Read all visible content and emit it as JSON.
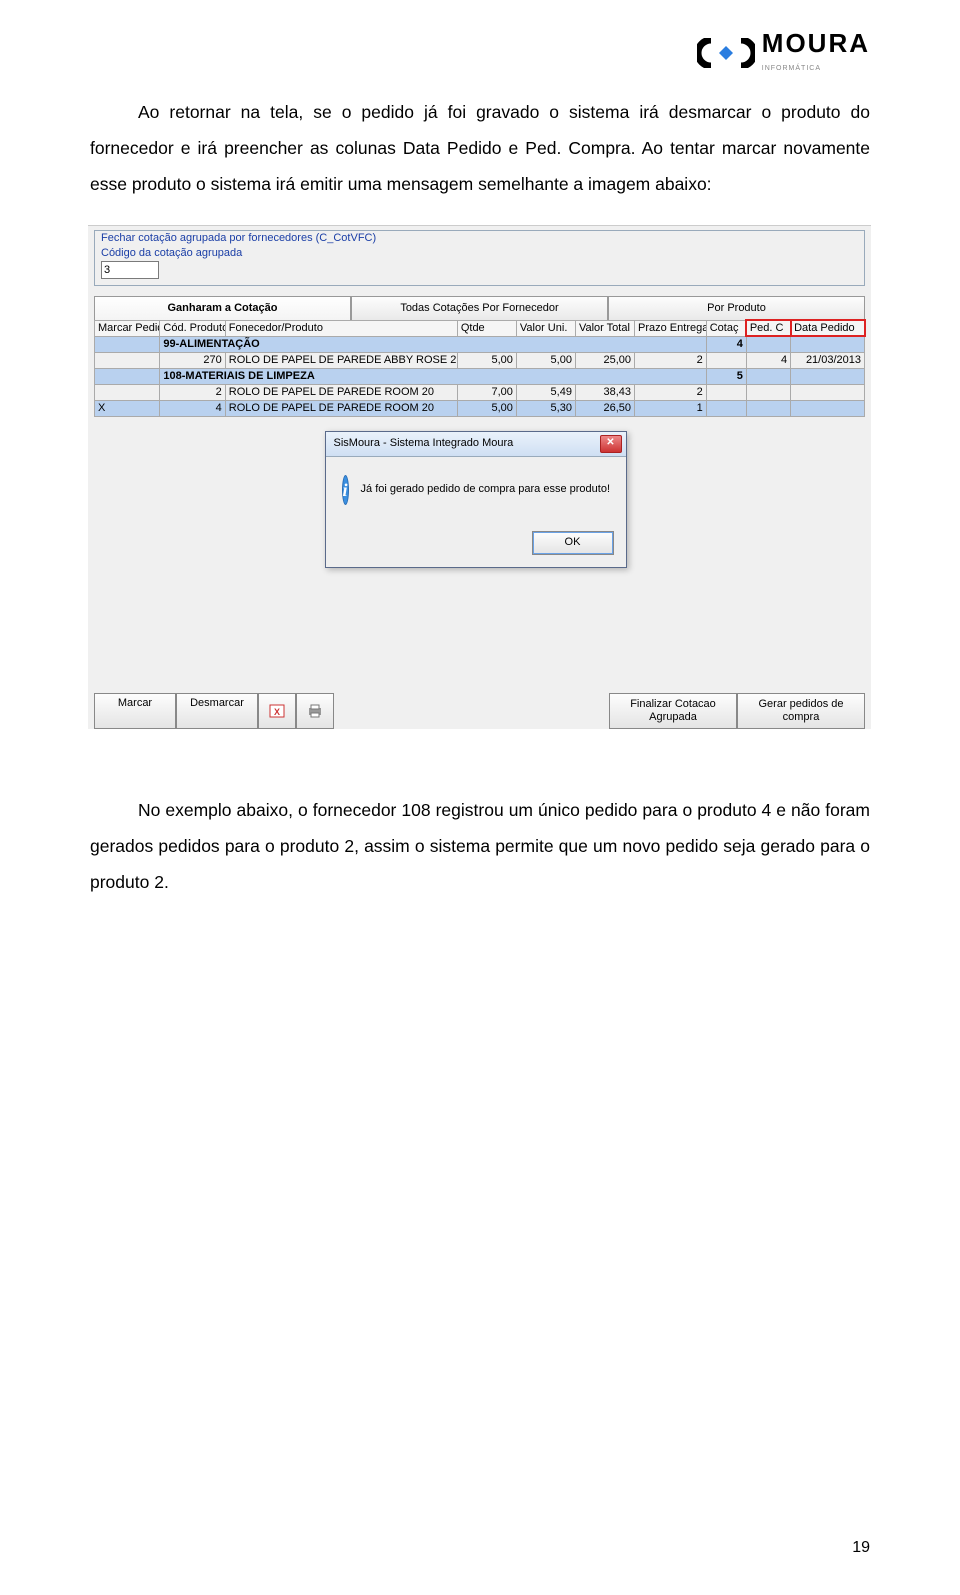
{
  "logo": {
    "brand": "MOURA",
    "sub": "INFORMÁTICA"
  },
  "para1": "Ao retornar na tela, se o pedido já foi gravado o sistema irá desmarcar o produto do fornecedor e irá preencher as colunas Data Pedido e Ped. Compra. Ao tentar marcar novamente esse produto o sistema irá emitir uma mensagem semelhante a imagem abaixo:",
  "para2": "No exemplo abaixo, o fornecedor 108 registrou um único pedido para o produto 4 e não foram gerados pedidos para o produto 2, assim o sistema permite que um novo pedido seja gerado para o produto 2.",
  "pagenum": "19",
  "shot": {
    "legend": "Fechar cotação agrupada por fornecedores (C_CotVFC)",
    "code_label": "Código da cotação agrupada",
    "code_value": "3",
    "tabs": [
      "Ganharam a Cotação",
      "Todas Cotações Por Fornecedor",
      "Por Produto"
    ],
    "cols": [
      "Marcar Pedid",
      "Cód. Produto",
      "Fonecedor/Produto",
      "Qtde",
      "Valor Uni.",
      "Valor Total",
      "Prazo Entrega",
      "Cotaç",
      "Ped. C",
      "Data Pedido"
    ],
    "rows": [
      {
        "type": "group",
        "label": "99-ALIMENTAÇÃO",
        "cotac": "4"
      },
      {
        "type": "data",
        "m": "",
        "cod": "270",
        "prod": "ROLO DE PAPEL DE PAREDE ABBY ROSE 2",
        "q": "5,00",
        "vu": "5,00",
        "vt": "25,00",
        "pe": "2",
        "cot": "",
        "pc": "4",
        "dp": "21/03/2013"
      },
      {
        "type": "group",
        "label": "108-MATERIAIS DE LIMPEZA",
        "cotac": "5"
      },
      {
        "type": "data",
        "m": "",
        "cod": "2",
        "prod": "ROLO DE PAPEL DE PAREDE ROOM 20",
        "q": "7,00",
        "vu": "5,49",
        "vt": "38,43",
        "pe": "2",
        "cot": "",
        "pc": "",
        "dp": ""
      },
      {
        "type": "data",
        "m": "X",
        "cod": "4",
        "prod": "ROLO DE PAPEL DE PAREDE ROOM 20",
        "q": "5,00",
        "vu": "5,30",
        "vt": "26,50",
        "pe": "1",
        "cot": "",
        "pc": "",
        "dp": ""
      }
    ],
    "buttons": {
      "marcar": "Marcar",
      "desmarcar": "Desmarcar",
      "finalizar": "Finalizar Cotacao\nAgrupada",
      "gerar": "Gerar pedidos de\ncompra"
    },
    "dialog": {
      "title": "SisMoura - Sistema Integrado Moura",
      "msg": "Já foi gerado pedido de compra para esse produto!",
      "ok": "OK"
    }
  }
}
